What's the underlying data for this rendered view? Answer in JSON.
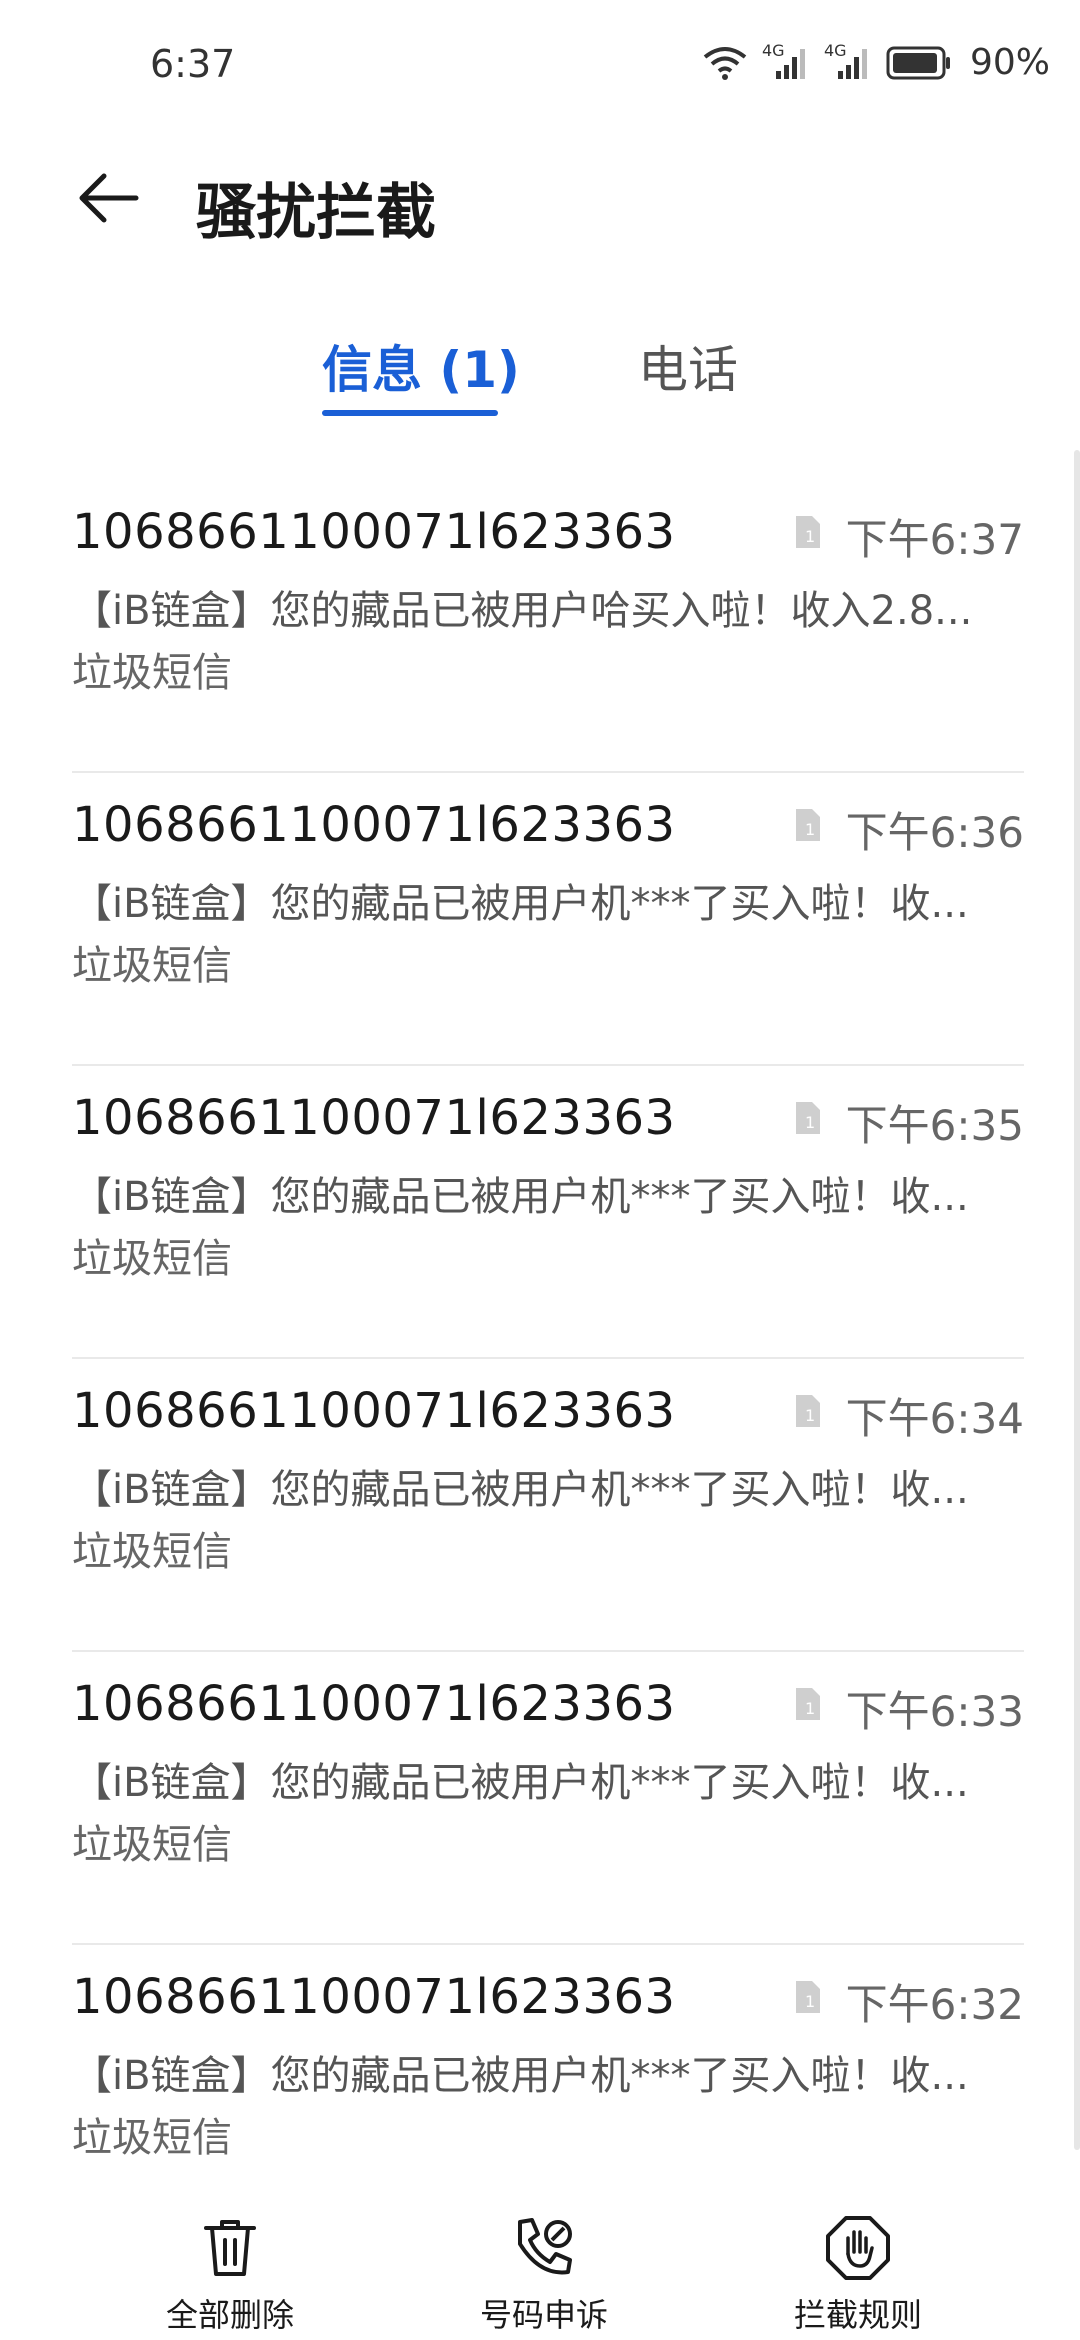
{
  "status_bar": {
    "time": "6:37",
    "network_1": "4G",
    "network_2": "4G",
    "battery": "90%"
  },
  "header": {
    "title": "骚扰拦截",
    "back_icon": "arrow-left-icon"
  },
  "tabs": [
    {
      "label": "信息 (1)",
      "active": true
    },
    {
      "label": "电话",
      "active": false
    }
  ],
  "accent_color": "#1a5fd6",
  "messages": [
    {
      "sender": "1068661100071l623363",
      "time": "下午6:37",
      "preview": "【iB链盒】您的藏品已被用户哈买入啦！收入2.8...",
      "tag": "垃圾短信"
    },
    {
      "sender": "1068661100071l623363",
      "time": "下午6:36",
      "preview": "【iB链盒】您的藏品已被用户机***了买入啦！收...",
      "tag": "垃圾短信"
    },
    {
      "sender": "1068661100071l623363",
      "time": "下午6:35",
      "preview": "【iB链盒】您的藏品已被用户机***了买入啦！收...",
      "tag": "垃圾短信"
    },
    {
      "sender": "1068661100071l623363",
      "time": "下午6:34",
      "preview": "【iB链盒】您的藏品已被用户机***了买入啦！收...",
      "tag": "垃圾短信"
    },
    {
      "sender": "1068661100071l623363",
      "time": "下午6:33",
      "preview": "【iB链盒】您的藏品已被用户机***了买入啦！收...",
      "tag": "垃圾短信"
    },
    {
      "sender": "1068661100071l623363",
      "time": "下午6:32",
      "preview": "【iB链盒】您的藏品已被用户机***了买入啦！收...",
      "tag": "垃圾短信"
    }
  ],
  "bottom_bar": {
    "delete_all": "全部删除",
    "number_appeal": "号码申诉",
    "block_rules": "拦截规则"
  }
}
